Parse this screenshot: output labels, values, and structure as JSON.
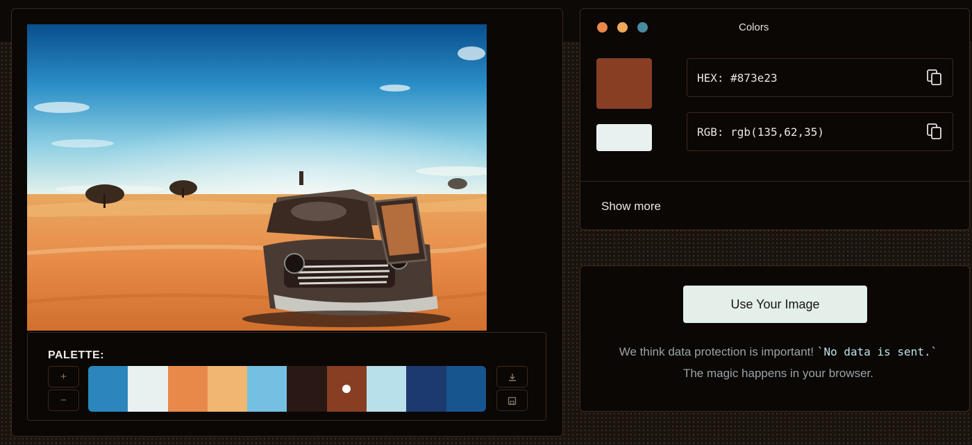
{
  "palette": {
    "label": "PALETTE:",
    "add_label": "+",
    "remove_label": "−",
    "download_icon": "download-icon",
    "save_icon": "save-icon",
    "swatches": [
      "#2a86bd",
      "#e8f1ef",
      "#e8894a",
      "#f0b672",
      "#74c0e2",
      "#2a1814",
      "#873e23",
      "#b8e0ea",
      "#1c3a6e",
      "#16558e"
    ],
    "selected_index": 6
  },
  "colors_panel": {
    "title": "Colors",
    "window_dots": [
      "#e8894a",
      "#f0a85a",
      "#4a8aa0"
    ],
    "main_color": "#873e23",
    "secondary_color": "#e8f1ef",
    "hex_text": "HEX: #873e23",
    "rgb_text": "RGB: rgb(135,62,35)",
    "show_more": "Show more"
  },
  "upload": {
    "button_label": "Use Your Image",
    "privacy_before": "We think data protection is important! ",
    "privacy_code": "`No data is sent.`",
    "privacy_after": " The magic happens in your browser."
  }
}
